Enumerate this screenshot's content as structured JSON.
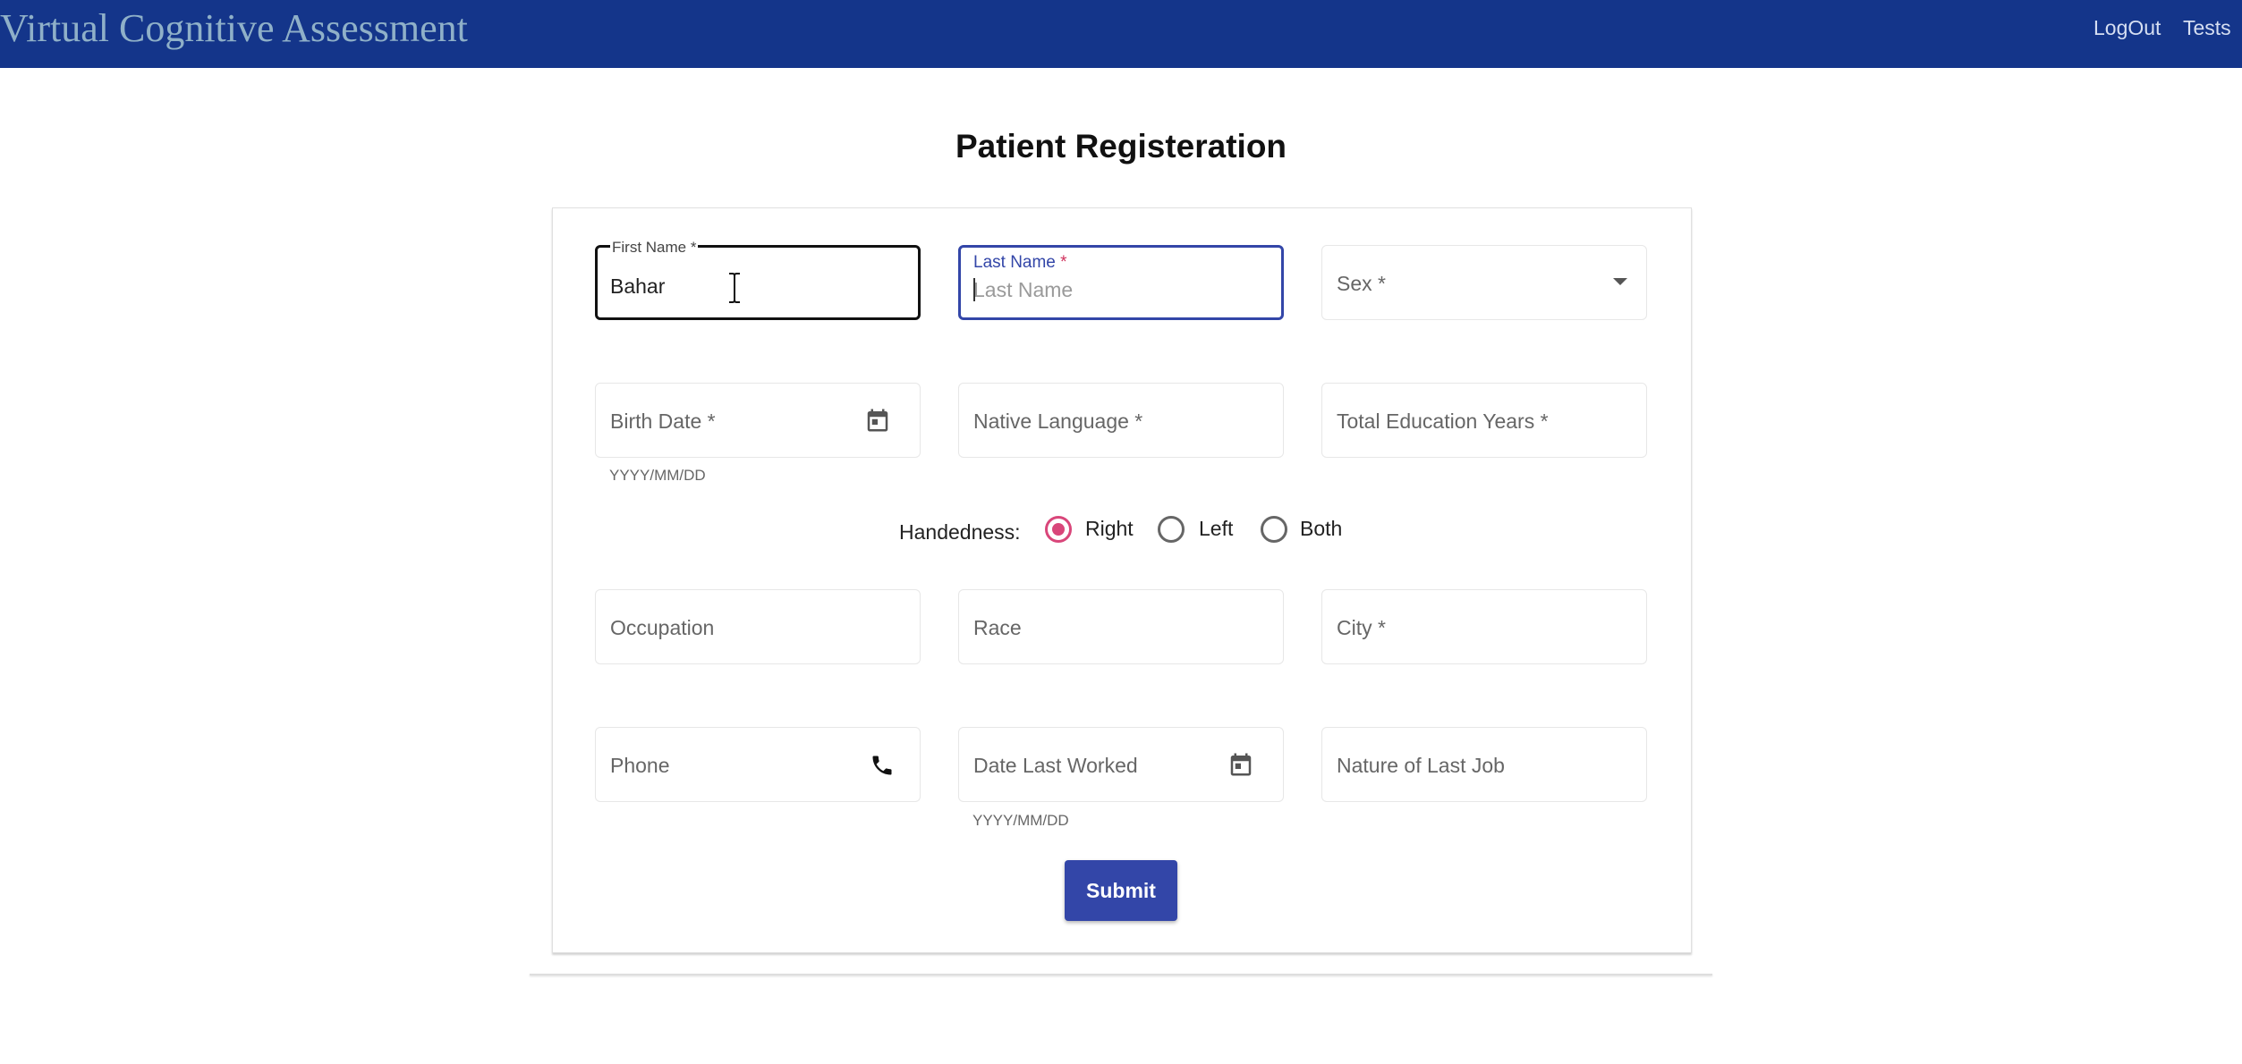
{
  "header": {
    "app_title": "Virtual Cognitive Assessment",
    "nav": {
      "logout": "LogOut",
      "tests": "Tests"
    },
    "bg_color": "#14358a"
  },
  "page": {
    "title": "Patient Registeration"
  },
  "form": {
    "first_name": {
      "label": "First Name *",
      "value": "Bahar"
    },
    "last_name": {
      "label": "Last Name",
      "required_mark": "*",
      "placeholder": "Last Name"
    },
    "sex": {
      "label": "Sex *",
      "icon": "dropdown-arrow-icon"
    },
    "birth_date": {
      "label": "Birth Date *",
      "helper": "YYYY/MM/DD",
      "icon": "calendar-icon"
    },
    "native_language": {
      "label": "Native Language *"
    },
    "total_education_years": {
      "label": "Total Education Years *"
    },
    "handedness": {
      "label": "Handedness:",
      "options": [
        "Right",
        "Left",
        "Both"
      ],
      "selected": "Right",
      "accent_color": "#d9467a"
    },
    "occupation": {
      "label": "Occupation"
    },
    "race": {
      "label": "Race"
    },
    "city": {
      "label": "City *"
    },
    "phone": {
      "label": "Phone",
      "icon": "phone-icon"
    },
    "date_last_worked": {
      "label": "Date Last Worked",
      "helper": "YYYY/MM/DD",
      "icon": "calendar-icon"
    },
    "nature_of_last_job": {
      "label": "Nature of Last Job"
    },
    "submit_label": "Submit",
    "primary_color": "#3346a8"
  }
}
